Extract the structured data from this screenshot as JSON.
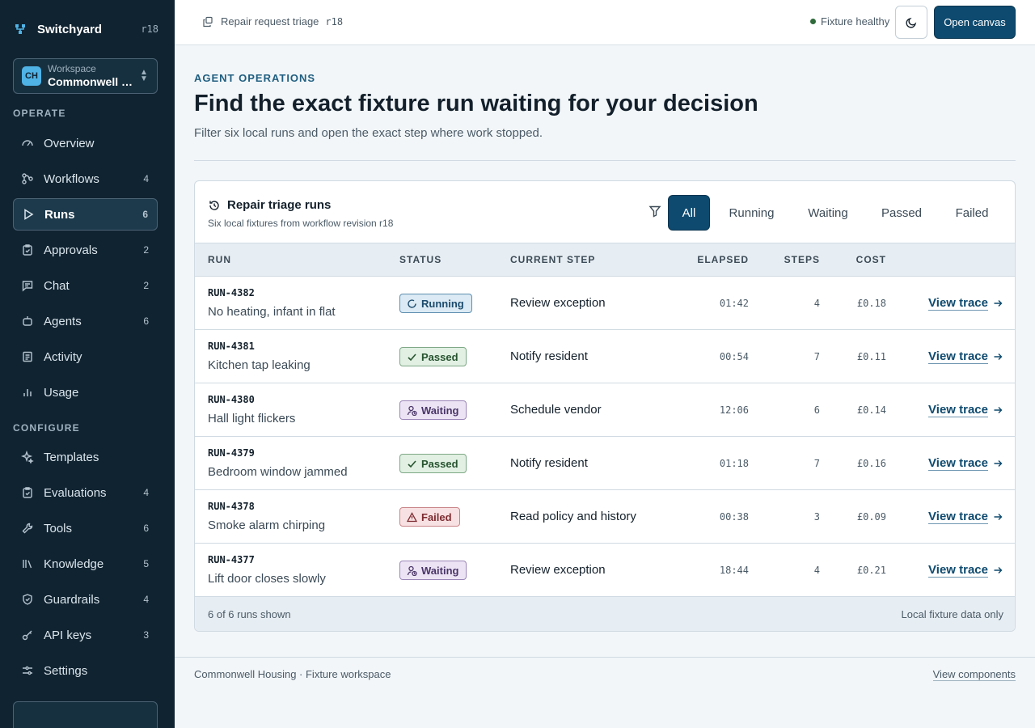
{
  "app": {
    "name": "Switchyard",
    "revision": "r18"
  },
  "workspace": {
    "label": "Workspace",
    "initials": "CH",
    "name": "Commonwell Housing"
  },
  "sidebar": {
    "operate_title": "OPERATE",
    "configure_title": "CONFIGURE",
    "operate": [
      {
        "label": "Overview",
        "count": "",
        "icon": "gauge-icon"
      },
      {
        "label": "Workflows",
        "count": "4",
        "icon": "workflow-icon"
      },
      {
        "label": "Runs",
        "count": "6",
        "icon": "play-icon",
        "active": true
      },
      {
        "label": "Approvals",
        "count": "2",
        "icon": "clipboard-check-icon"
      },
      {
        "label": "Chat",
        "count": "2",
        "icon": "chat-icon"
      },
      {
        "label": "Agents",
        "count": "6",
        "icon": "bot-icon"
      },
      {
        "label": "Activity",
        "count": "",
        "icon": "activity-icon"
      },
      {
        "label": "Usage",
        "count": "",
        "icon": "bar-chart-icon"
      }
    ],
    "configure": [
      {
        "label": "Templates",
        "count": "",
        "icon": "sparkle-icon"
      },
      {
        "label": "Evaluations",
        "count": "4",
        "icon": "clipboard-icon"
      },
      {
        "label": "Tools",
        "count": "6",
        "icon": "wrench-icon"
      },
      {
        "label": "Knowledge",
        "count": "5",
        "icon": "library-icon"
      },
      {
        "label": "Guardrails",
        "count": "4",
        "icon": "shield-icon"
      },
      {
        "label": "API keys",
        "count": "3",
        "icon": "key-icon"
      },
      {
        "label": "Settings",
        "count": "",
        "icon": "sliders-icon"
      }
    ]
  },
  "topbar": {
    "breadcrumb": "Repair request triage",
    "breadcrumb_rev": "r18",
    "health": "Fixture healthy",
    "open_canvas": "Open canvas"
  },
  "page": {
    "eyebrow": "AGENT OPERATIONS",
    "title": "Find the exact fixture run waiting for your decision",
    "subtitle": "Filter six local runs and open the exact step where work stopped."
  },
  "runs_card": {
    "title": "Repair triage runs",
    "subtitle": "Six local fixtures from workflow revision r18",
    "tabs": [
      "All",
      "Running",
      "Waiting",
      "Passed",
      "Failed"
    ],
    "active_tab": "All",
    "columns": {
      "run": "RUN",
      "status": "STATUS",
      "step": "CURRENT STEP",
      "elapsed": "ELAPSED",
      "steps": "STEPS",
      "cost": "COST"
    },
    "rows": [
      {
        "id": "RUN-4382",
        "name": "No heating, infant in flat",
        "status": "Running",
        "status_key": "running",
        "step": "Review exception",
        "elapsed": "01:42",
        "steps": "4",
        "cost": "£0.18",
        "action": "View trace"
      },
      {
        "id": "RUN-4381",
        "name": "Kitchen tap leaking",
        "status": "Passed",
        "status_key": "passed",
        "step": "Notify resident",
        "elapsed": "00:54",
        "steps": "7",
        "cost": "£0.11",
        "action": "View trace"
      },
      {
        "id": "RUN-4380",
        "name": "Hall light flickers",
        "status": "Waiting",
        "status_key": "waiting",
        "step": "Schedule vendor",
        "elapsed": "12:06",
        "steps": "6",
        "cost": "£0.14",
        "action": "View trace"
      },
      {
        "id": "RUN-4379",
        "name": "Bedroom window jammed",
        "status": "Passed",
        "status_key": "passed",
        "step": "Notify resident",
        "elapsed": "01:18",
        "steps": "7",
        "cost": "£0.16",
        "action": "View trace"
      },
      {
        "id": "RUN-4378",
        "name": "Smoke alarm chirping",
        "status": "Failed",
        "status_key": "failed",
        "step": "Read policy and history",
        "elapsed": "00:38",
        "steps": "3",
        "cost": "£0.09",
        "action": "View trace"
      },
      {
        "id": "RUN-4377",
        "name": "Lift door closes slowly",
        "status": "Waiting",
        "status_key": "waiting",
        "step": "Review exception",
        "elapsed": "18:44",
        "steps": "4",
        "cost": "£0.21",
        "action": "View trace"
      }
    ],
    "footer_left": "6 of 6 runs shown",
    "footer_right": "Local fixture data only"
  },
  "footer": {
    "left": "Commonwell Housing · Fixture workspace",
    "right": "View components"
  },
  "colors": {
    "sidebar_bg": "#102331",
    "accent": "#0e4a6f",
    "health": "#2f6a3a"
  }
}
